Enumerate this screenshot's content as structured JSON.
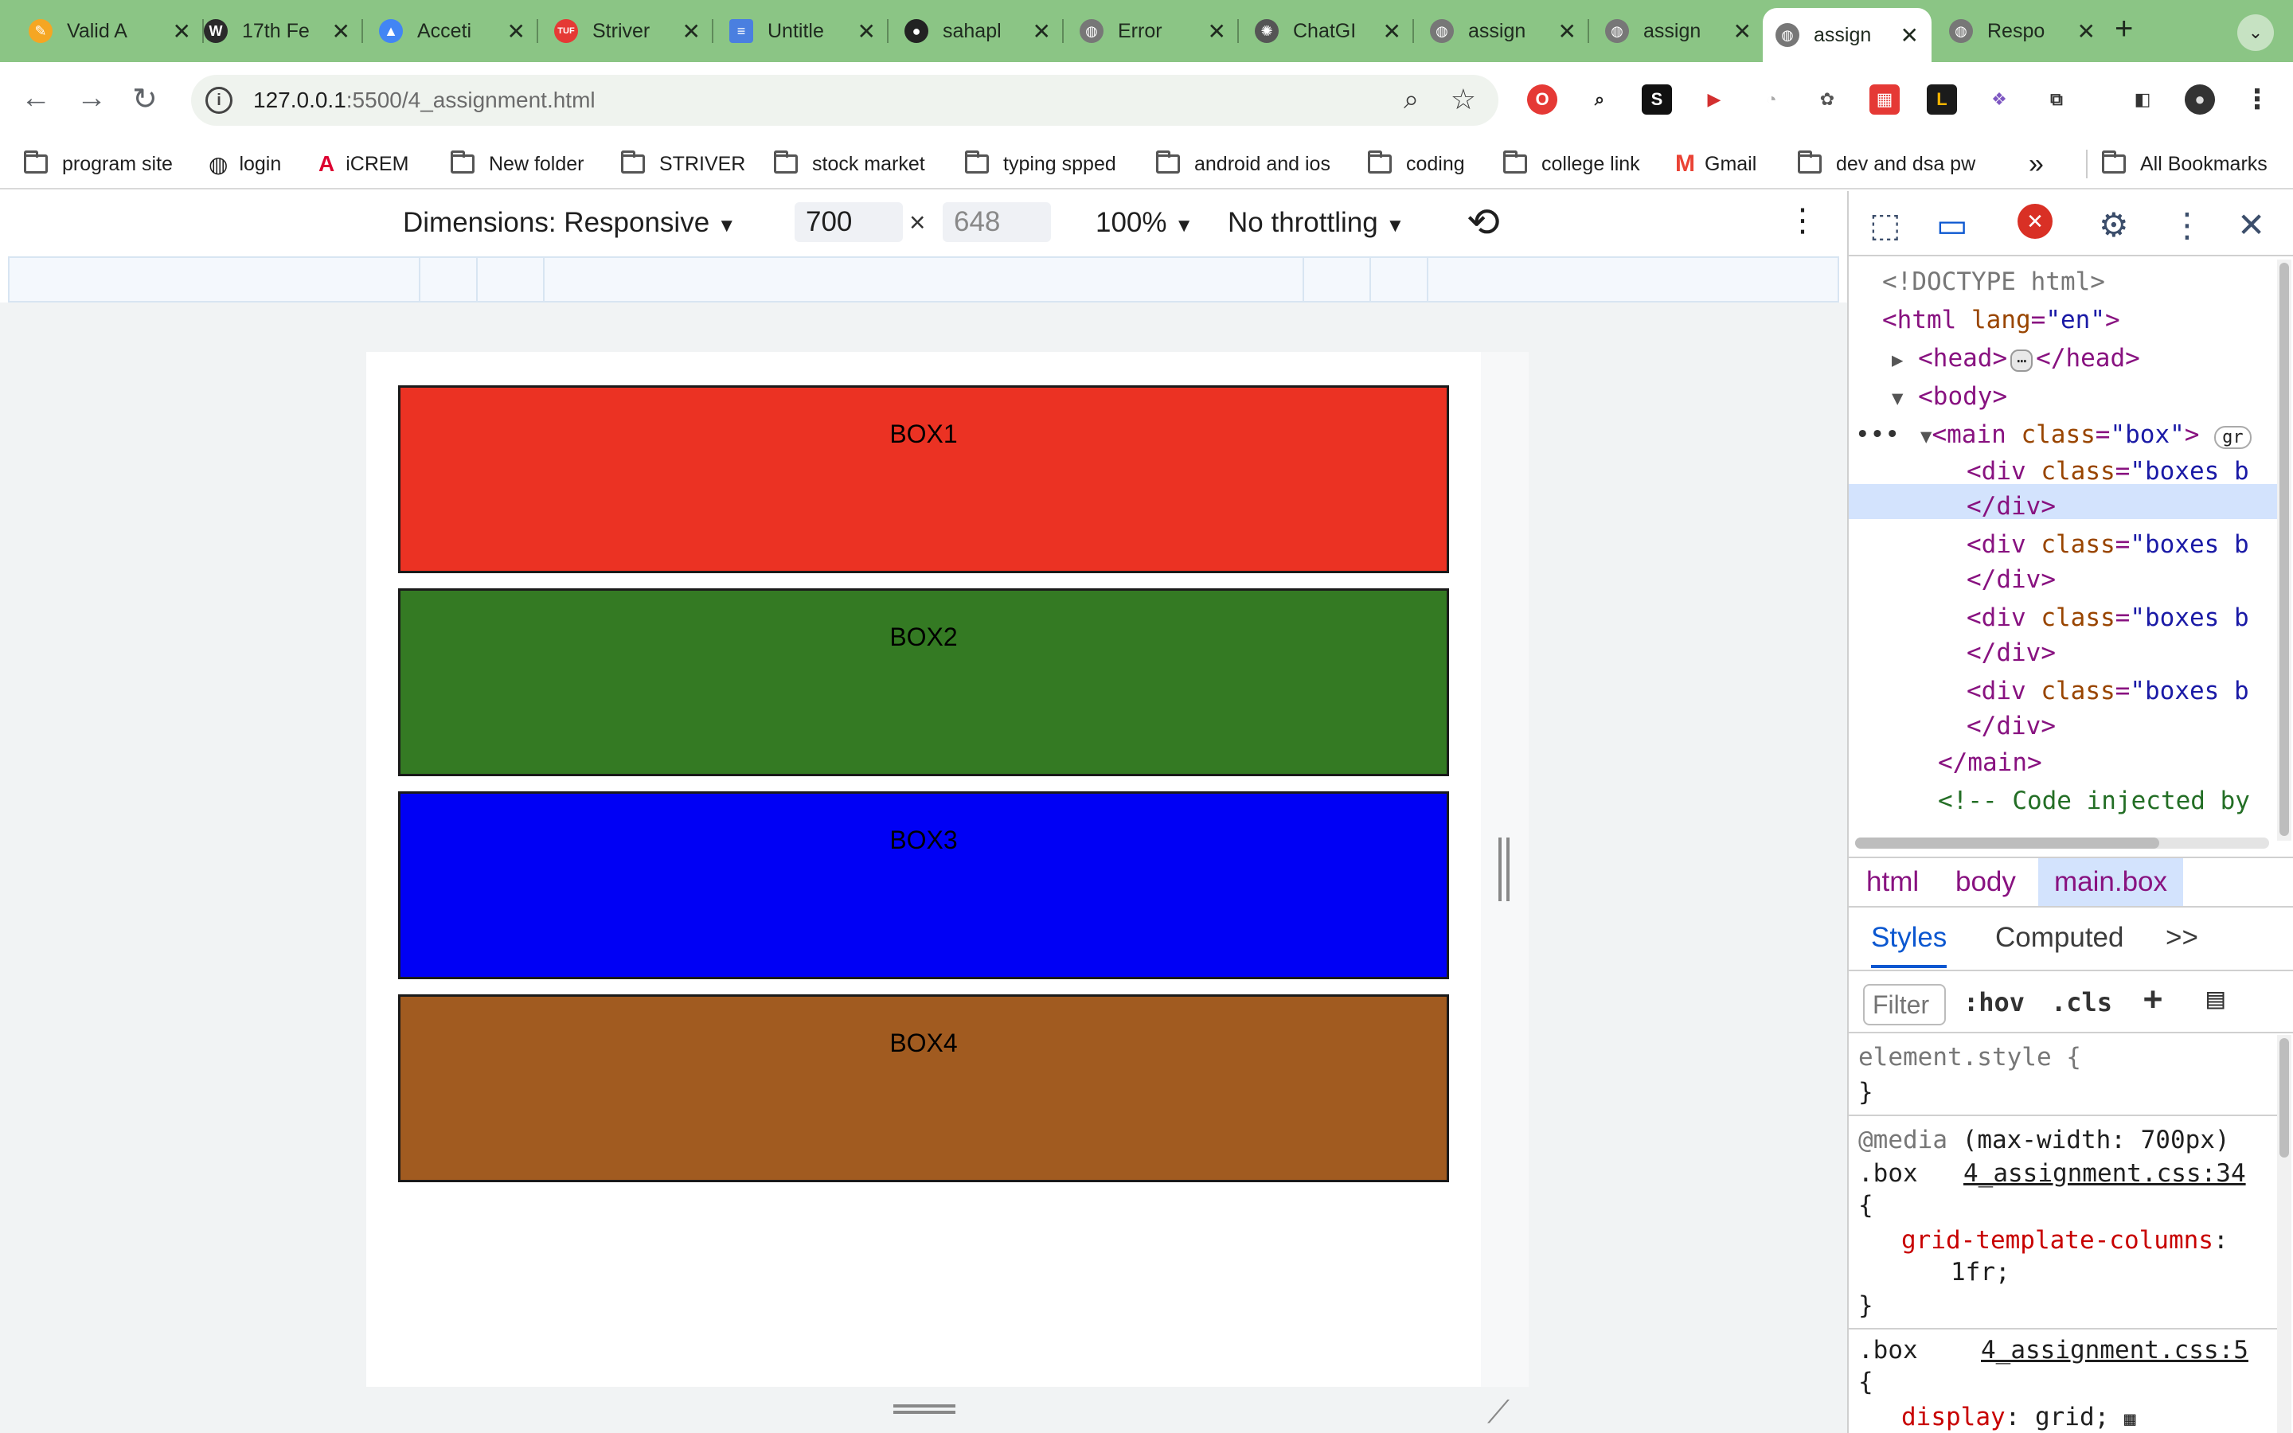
{
  "tabs": [
    {
      "title": "Valid A",
      "favicon": "pen-icon",
      "color": "#f5a623"
    },
    {
      "title": "17th Fe",
      "favicon": "wordpress-icon",
      "color": "#2a2a2a"
    },
    {
      "title": "Acceti",
      "favicon": "drive-icon",
      "color": "#4285f4"
    },
    {
      "title": "Striver",
      "favicon": "tuf-icon",
      "color": "#e53935"
    },
    {
      "title": "Untitle",
      "favicon": "docs-icon",
      "color": "#4a7fe0"
    },
    {
      "title": "sahapl",
      "favicon": "github-icon",
      "color": "#222222"
    },
    {
      "title": "Error",
      "favicon": "globe-icon",
      "color": "#777777"
    },
    {
      "title": "ChatGI",
      "favicon": "chatgpt-icon",
      "color": "#555555"
    },
    {
      "title": "assign",
      "favicon": "globe-icon",
      "color": "#777777"
    },
    {
      "title": "assign",
      "favicon": "globe-icon",
      "color": "#777777"
    },
    {
      "title": "assign",
      "favicon": "globe-icon",
      "color": "#777777",
      "active": true
    },
    {
      "title": "Respo",
      "favicon": "globe-icon",
      "color": "#777777"
    }
  ],
  "address": {
    "host": "127.0.0.1",
    "rest": ":5500/4_assignment.html"
  },
  "bookmarks": [
    {
      "label": "program site",
      "icon": "folder-icon"
    },
    {
      "label": "login",
      "icon": "globe-icon"
    },
    {
      "label": "iCREM",
      "icon": "angular-icon"
    },
    {
      "label": "New folder",
      "icon": "folder-icon"
    },
    {
      "label": "STRIVER",
      "icon": "folder-icon"
    },
    {
      "label": "stock market",
      "icon": "folder-icon"
    },
    {
      "label": "typing spped",
      "icon": "folder-icon"
    },
    {
      "label": "android and ios",
      "icon": "folder-icon"
    },
    {
      "label": "coding",
      "icon": "folder-icon"
    },
    {
      "label": "college link",
      "icon": "folder-icon"
    },
    {
      "label": "Gmail",
      "icon": "gmail-icon"
    },
    {
      "label": "dev and dsa pw",
      "icon": "folder-icon"
    }
  ],
  "bookmarks_more": "»",
  "all_bookmarks": "All Bookmarks",
  "device": {
    "dimensions": "Dimensions: Responsive",
    "width": "700",
    "height": "648",
    "times": "×",
    "zoom": "100%",
    "throttling": "No throttling"
  },
  "page": {
    "boxes": [
      {
        "label": "BOX1",
        "color": "#eb3223"
      },
      {
        "label": "BOX2",
        "color": "#347a23"
      },
      {
        "label": "BOX3",
        "color": "#0000f5"
      },
      {
        "label": "BOX4",
        "color": "#a15b20"
      }
    ]
  },
  "devtools": {
    "dom": {
      "doctype": "<!DOCTYPE html>",
      "html_open": "<html",
      "html_attr": "lang",
      "html_val": "\"en\"",
      "head": "<head>",
      "head_close": "</head>",
      "body": "<body>",
      "main_open": "<main",
      "main_attr": "class",
      "main_val": "\"box\"",
      "grid_badge": "gr",
      "div_open": "<div",
      "div_attr": "class",
      "div_val": "\"boxes b",
      "div_close": "</div>",
      "main_close": "</main>",
      "comment": "<!-- Code injected by"
    },
    "crumbs": [
      "html",
      "body",
      "main.box"
    ],
    "panel_tabs": [
      "Styles",
      "Computed",
      ">>"
    ],
    "filter_placeholder": "Filter",
    "hov": ":hov",
    "cls": ".cls",
    "styles": {
      "element_style": "element.style {",
      "close_brace": "}",
      "media": "@media",
      "media_query": "(max-width: 700px)",
      "selector": ".box",
      "source1": "4_assignment.css:34",
      "open_brace": "{",
      "prop1": "grid-template-columns",
      "value1": "1fr;",
      "source2": "4_assignment.css:5",
      "prop2": "display",
      "value2": "grid;"
    }
  }
}
